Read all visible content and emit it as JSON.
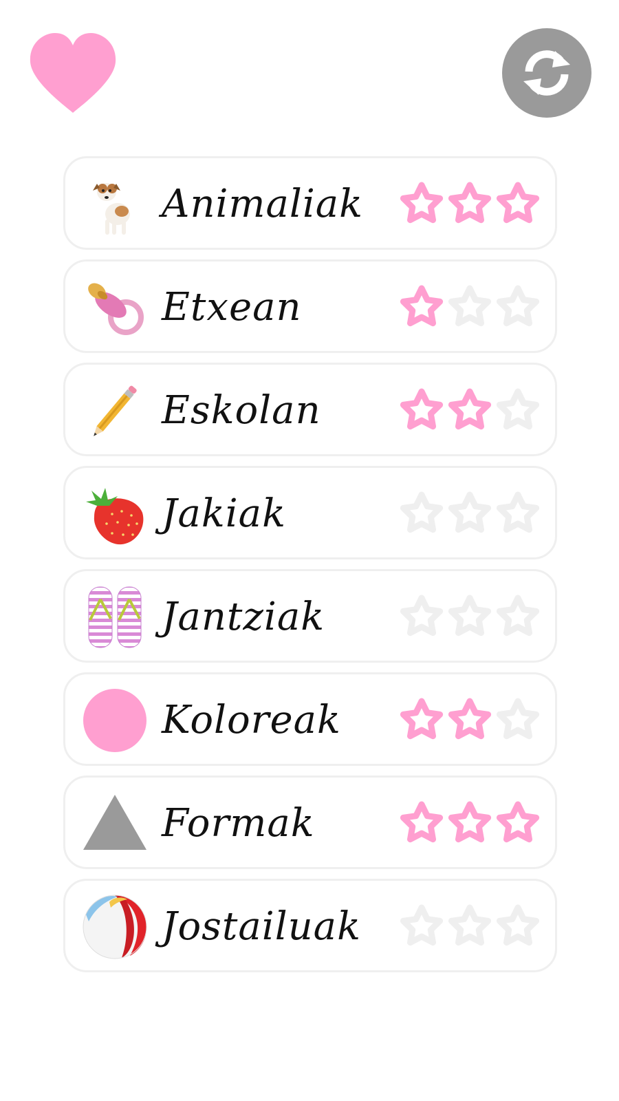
{
  "header": {
    "favorites_icon": "heart-icon",
    "refresh_icon": "refresh-icon"
  },
  "colors": {
    "pink": "#ff9fd0",
    "star_empty": "#efefef",
    "grey": "#9a9a9a"
  },
  "categories": [
    {
      "label": "Animaliak",
      "icon": "dog-icon",
      "stars": 3
    },
    {
      "label": "Etxean",
      "icon": "pacifier-icon",
      "stars": 1
    },
    {
      "label": "Eskolan",
      "icon": "pencil-icon",
      "stars": 2
    },
    {
      "label": "Jakiak",
      "icon": "strawberry-icon",
      "stars": 0
    },
    {
      "label": "Jantziak",
      "icon": "flip-flops-icon",
      "stars": 0
    },
    {
      "label": "Koloreak",
      "icon": "pink-circle-icon",
      "stars": 2
    },
    {
      "label": "Formak",
      "icon": "triangle-icon",
      "stars": 3
    },
    {
      "label": "Jostailuak",
      "icon": "beach-ball-icon",
      "stars": 0
    }
  ],
  "max_stars": 3
}
